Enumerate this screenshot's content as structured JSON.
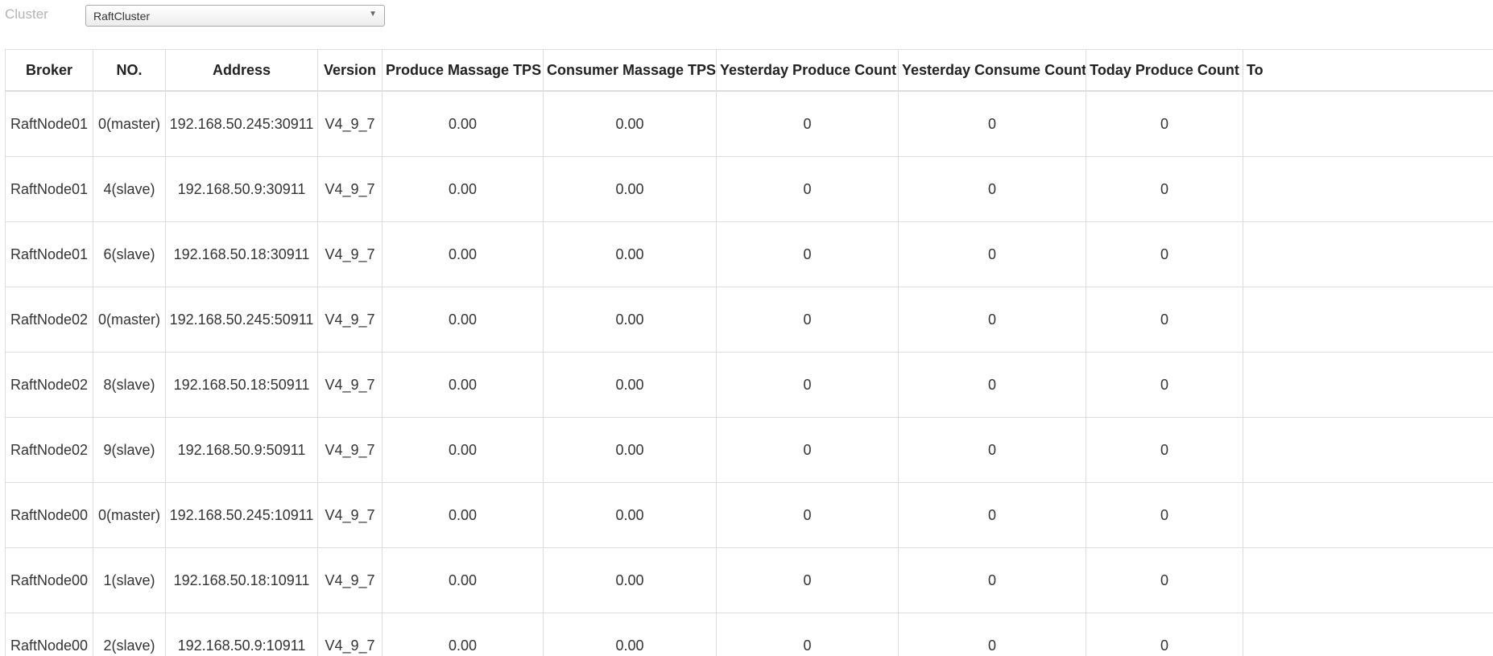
{
  "cluster_bar": {
    "label": "Cluster",
    "selected": "RaftCluster",
    "caret_icon": "chevron-down-icon"
  },
  "table": {
    "columns": [
      "Broker",
      "NO.",
      "Address",
      "Version",
      "Produce Massage TPS",
      "Consumer Massage TPS",
      "Yesterday Produce Count",
      "Yesterday Consume Count",
      "Today Produce Count",
      "To"
    ],
    "rows": [
      {
        "broker": "RaftNode01",
        "no": "0(master)",
        "address": "192.168.50.245:30911",
        "version": "V4_9_7",
        "produce_tps": "0.00",
        "consumer_tps": "0.00",
        "yesterday_produce": "0",
        "yesterday_consume": "0",
        "today_produce": "0",
        "today_consume": ""
      },
      {
        "broker": "RaftNode01",
        "no": "4(slave)",
        "address": "192.168.50.9:30911",
        "version": "V4_9_7",
        "produce_tps": "0.00",
        "consumer_tps": "0.00",
        "yesterday_produce": "0",
        "yesterday_consume": "0",
        "today_produce": "0",
        "today_consume": ""
      },
      {
        "broker": "RaftNode01",
        "no": "6(slave)",
        "address": "192.168.50.18:30911",
        "version": "V4_9_7",
        "produce_tps": "0.00",
        "consumer_tps": "0.00",
        "yesterday_produce": "0",
        "yesterday_consume": "0",
        "today_produce": "0",
        "today_consume": ""
      },
      {
        "broker": "RaftNode02",
        "no": "0(master)",
        "address": "192.168.50.245:50911",
        "version": "V4_9_7",
        "produce_tps": "0.00",
        "consumer_tps": "0.00",
        "yesterday_produce": "0",
        "yesterday_consume": "0",
        "today_produce": "0",
        "today_consume": ""
      },
      {
        "broker": "RaftNode02",
        "no": "8(slave)",
        "address": "192.168.50.18:50911",
        "version": "V4_9_7",
        "produce_tps": "0.00",
        "consumer_tps": "0.00",
        "yesterday_produce": "0",
        "yesterday_consume": "0",
        "today_produce": "0",
        "today_consume": ""
      },
      {
        "broker": "RaftNode02",
        "no": "9(slave)",
        "address": "192.168.50.9:50911",
        "version": "V4_9_7",
        "produce_tps": "0.00",
        "consumer_tps": "0.00",
        "yesterday_produce": "0",
        "yesterday_consume": "0",
        "today_produce": "0",
        "today_consume": ""
      },
      {
        "broker": "RaftNode00",
        "no": "0(master)",
        "address": "192.168.50.245:10911",
        "version": "V4_9_7",
        "produce_tps": "0.00",
        "consumer_tps": "0.00",
        "yesterday_produce": "0",
        "yesterday_consume": "0",
        "today_produce": "0",
        "today_consume": ""
      },
      {
        "broker": "RaftNode00",
        "no": "1(slave)",
        "address": "192.168.50.18:10911",
        "version": "V4_9_7",
        "produce_tps": "0.00",
        "consumer_tps": "0.00",
        "yesterday_produce": "0",
        "yesterday_consume": "0",
        "today_produce": "0",
        "today_consume": ""
      },
      {
        "broker": "RaftNode00",
        "no": "2(slave)",
        "address": "192.168.50.9:10911",
        "version": "V4_9_7",
        "produce_tps": "0.00",
        "consumer_tps": "0.00",
        "yesterday_produce": "0",
        "yesterday_consume": "0",
        "today_produce": "0",
        "today_consume": ""
      }
    ]
  }
}
